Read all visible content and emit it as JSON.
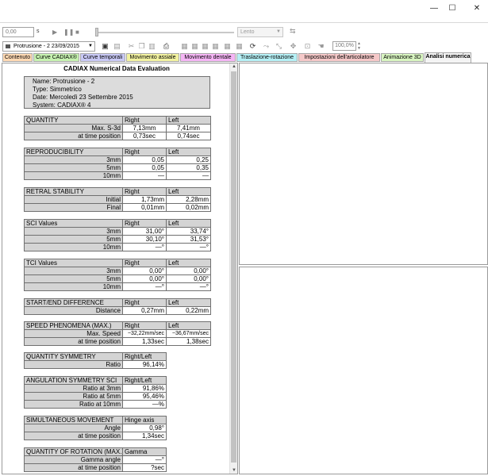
{
  "window": {
    "minimize": "—",
    "maximize": "☐",
    "close": "✕"
  },
  "playback": {
    "time_value": "0,00",
    "time_unit": "s",
    "speed": "Lento"
  },
  "record": {
    "selected": "Protrusione - 2 23/09/2015"
  },
  "zoom": "100,0%",
  "tabs": [
    {
      "label": "Contenuto",
      "color": "#ffd9b3"
    },
    {
      "label": "Curve CADIAX®",
      "color": "#c6f2b0"
    },
    {
      "label": "Curve temporali",
      "color": "#c8c8f5"
    },
    {
      "label": "Movimento assiale",
      "color": "#f2f2a0"
    },
    {
      "label": "Movimento dentale",
      "color": "#f5b5f5"
    },
    {
      "label": "Traslazione-rotazione",
      "color": "#b5f0f5"
    },
    {
      "label": "Impostazioni dell'articolatore",
      "color": "#f5c8c8"
    },
    {
      "label": "Animazione 3D",
      "color": "#d8f5c0"
    },
    {
      "label": "Analisi numerica",
      "color": "#f4f4f4"
    }
  ],
  "report": {
    "title": "CADIAX Numerical Data Evaluation",
    "info": {
      "name": "Name: Protrusione - 2",
      "type": "Type: Simmetrico",
      "date": "Date: Mercoledì 23 Settembre 2015",
      "system": "System: CADIAX® 4"
    },
    "quantity": {
      "header": [
        "QUANTITY",
        "Right",
        "Left"
      ],
      "rows": [
        [
          "Max. S-3d",
          "7,13mm",
          "7,41mm"
        ],
        [
          "at time position",
          "0,73sec",
          "0,74sec"
        ]
      ]
    },
    "reproducibility": {
      "header": [
        "REPRODUCIBILITY",
        "Right",
        "Left"
      ],
      "rows": [
        [
          "3mm",
          "0,05",
          "0,25"
        ],
        [
          "5mm",
          "0,05",
          "0,35"
        ],
        [
          "10mm",
          "—",
          "—"
        ]
      ]
    },
    "retral": {
      "header": [
        "RETRAL STABILITY",
        "Right",
        "Left"
      ],
      "rows": [
        [
          "Initial",
          "1,73mm",
          "2,28mm"
        ],
        [
          "Final",
          "0,01mm",
          "0,02mm"
        ]
      ]
    },
    "sci": {
      "header": [
        "SCI Values",
        "Right",
        "Left"
      ],
      "rows": [
        [
          "3mm",
          "31,00°",
          "33,74°"
        ],
        [
          "5mm",
          "30,10°",
          "31,53°"
        ],
        [
          "10mm",
          "—°",
          "—°"
        ]
      ]
    },
    "tci": {
      "header": [
        "TCI Values",
        "Right",
        "Left"
      ],
      "rows": [
        [
          "3mm",
          "0,00°",
          "0,00°"
        ],
        [
          "5mm",
          "0,00°",
          "0,00°"
        ],
        [
          "10mm",
          "—°",
          "—°"
        ]
      ]
    },
    "startend": {
      "header": [
        "START/END DIFFERENCE",
        "Right",
        "Left"
      ],
      "rows": [
        [
          "Distance",
          "0,27mm",
          "0,22mm"
        ]
      ]
    },
    "speed": {
      "header": [
        "SPEED PHENOMENA (MAX.)",
        "Right",
        "Left"
      ],
      "rows": [
        [
          "Max. Speed",
          "−32,22mm/sec",
          "−36,67mm/sec"
        ],
        [
          "at time position",
          "1,33sec",
          "1,38sec"
        ]
      ]
    },
    "qsym": {
      "header": [
        "QUANTITY SYMMETRY",
        "Right/Left"
      ],
      "rows": [
        [
          "Ratio",
          "96,14%"
        ]
      ]
    },
    "angsym": {
      "header": [
        "ANGULATION SYMMETRY SCI",
        "Right/Left"
      ],
      "rows": [
        [
          "Ratio at 3mm",
          "91,86%"
        ],
        [
          "Ratio at 5mm",
          "95,46%"
        ],
        [
          "Ratio at 10mm",
          "—%"
        ]
      ]
    },
    "simul": {
      "header": [
        "SIMULTANEOUS MOVEMENT",
        "Hinge axis"
      ],
      "rows": [
        [
          "Angle",
          "0,98°"
        ],
        [
          "at time position",
          "1,34sec"
        ]
      ]
    },
    "rotation": {
      "header": [
        "QUANTITY OF ROTATION (MAX.)",
        "Gamma"
      ],
      "rows": [
        [
          "Gamma angle",
          "—°"
        ],
        [
          "at time position",
          "?sec"
        ]
      ]
    }
  }
}
